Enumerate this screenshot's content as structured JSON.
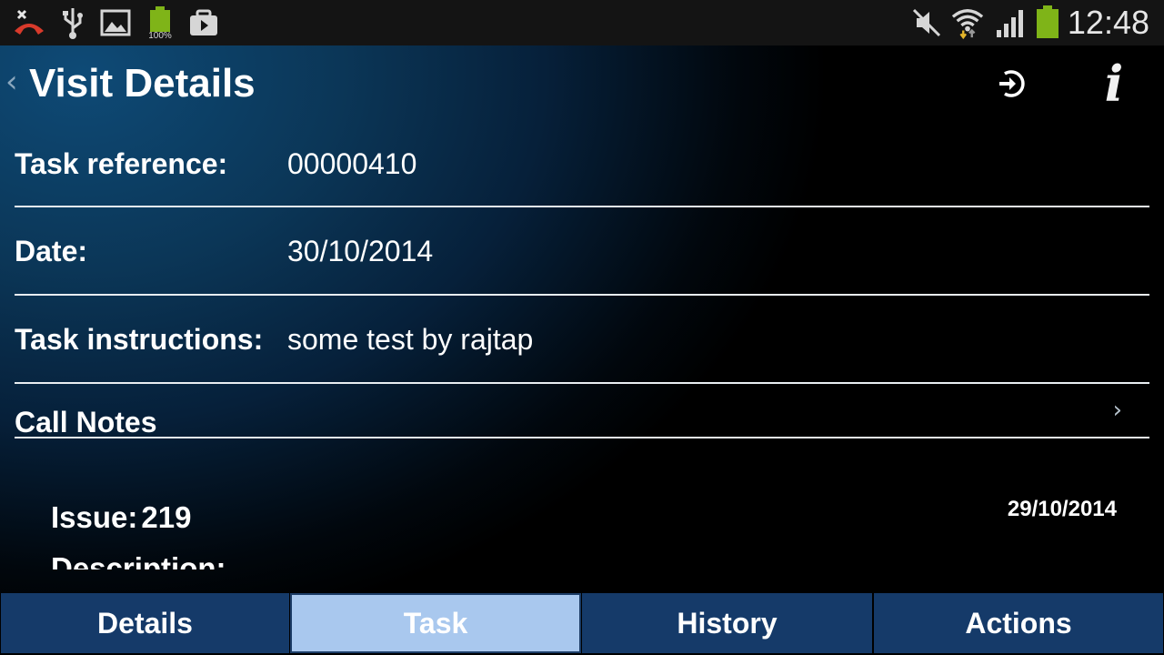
{
  "status_bar": {
    "time": "12:48",
    "battery_level_text": "100%",
    "icons": [
      "missed-call-icon",
      "usb-icon",
      "image-icon",
      "battery-full-icon",
      "media-icon",
      "mute-icon",
      "wifi-icon",
      "signal-icon",
      "battery-icon"
    ]
  },
  "header": {
    "back_symbol": "‹",
    "title": "Visit Details",
    "info_symbol": "i"
  },
  "fields": {
    "task_reference": {
      "label": "Task reference:",
      "value": "00000410"
    },
    "date": {
      "label": "Date:",
      "value": "30/10/2014"
    },
    "task_instructions": {
      "label": "Task instructions:",
      "value": "some test by rajtap"
    },
    "call_notes": {
      "label": "Call Notes",
      "chevron": "›"
    }
  },
  "issue": {
    "label": "Issue:",
    "number": "219",
    "date": "29/10/2014",
    "description_label": "Description:"
  },
  "tabs": [
    {
      "label": "Details",
      "active": false
    },
    {
      "label": "Task",
      "active": true
    },
    {
      "label": "History",
      "active": false
    },
    {
      "label": "Actions",
      "active": false
    }
  ],
  "colors": {
    "tab_inactive": "#153a69",
    "tab_active": "#a9c8ee",
    "battery_green": "#7fb418"
  }
}
